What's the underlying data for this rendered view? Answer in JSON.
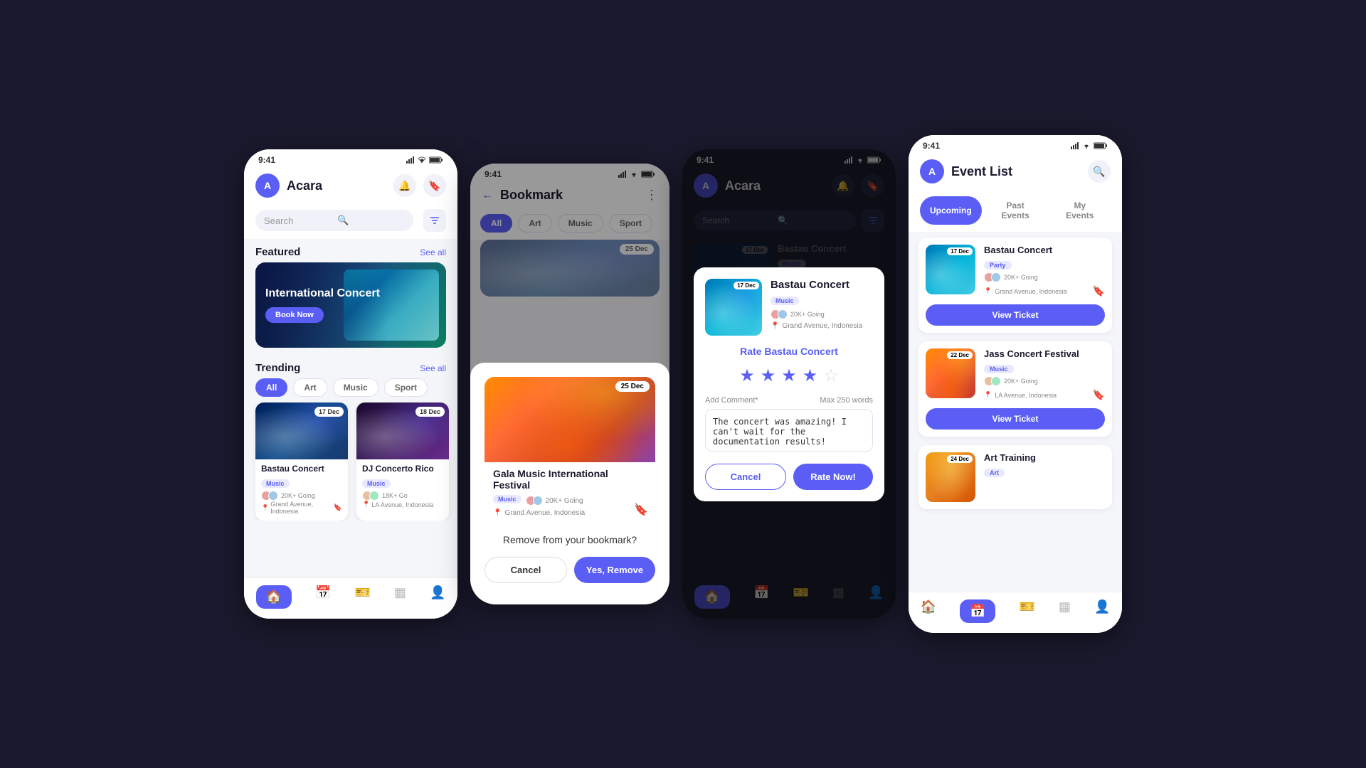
{
  "phone1": {
    "status": {
      "time": "9:41",
      "icons": "▲▲ ▲ ▮▮▮"
    },
    "header": {
      "app_name": "Acara",
      "avatar_letter": "A"
    },
    "search": {
      "placeholder": "Search"
    },
    "featured": {
      "section_label": "Featured",
      "see_all": "See all",
      "card_title": "International Concert",
      "book_btn": "Book Now"
    },
    "trending": {
      "section_label": "Trending",
      "see_all": "See all",
      "categories": [
        "All",
        "Art",
        "Music",
        "Sport"
      ],
      "events": [
        {
          "name": "Bastau Concert",
          "date": "17 Dec",
          "tag": "Music",
          "going": "20K+ Going",
          "location": "Grand Avenue, Indonesia"
        },
        {
          "name": "DJ Concerto Rico",
          "date": "18 Dec",
          "tag": "Music",
          "going": "18K+ Go",
          "location": "LA Avenue, Indonesia"
        }
      ]
    },
    "nav": [
      "home",
      "calendar",
      "ticket",
      "grid",
      "person"
    ]
  },
  "phone2": {
    "status": {
      "time": "9:41"
    },
    "header": {
      "title": "Bookmark"
    },
    "categories": [
      "All",
      "Art",
      "Music",
      "Sport"
    ],
    "card": {
      "date": "25 Dec",
      "name": "Gala Music International Festival",
      "tag": "Music",
      "going": "20K+ Going",
      "location": "Grand Avenue, Indonesia"
    },
    "modal": {
      "question": "Remove from your bookmark?",
      "cancel": "Cancel",
      "confirm": "Yes, Remove"
    }
  },
  "phone3": {
    "status": {
      "time": "9:41"
    },
    "header": {
      "app_name": "Acara",
      "search_placeholder": "Search"
    },
    "rate_modal": {
      "event": {
        "date": "17 Dec",
        "name": "Bastau Concert",
        "tag": "Music",
        "going": "20K+ Going",
        "location": "Grand Avenue, Indonesia"
      },
      "title_prefix": "Rate ",
      "title_event": "Bastau Concert",
      "stars": 4,
      "total_stars": 5,
      "comment_label": "Add Comment*",
      "max_words": "Max 250 words",
      "comment_text": "The concert was amazing! I can't wait for the documentation results!",
      "cancel": "Cancel",
      "rate_now": "Rate Now!"
    },
    "nav": [
      "home",
      "calendar",
      "ticket",
      "grid",
      "person"
    ]
  },
  "phone4": {
    "status": {
      "time": "9:41"
    },
    "header": {
      "title": "Event List"
    },
    "tabs": [
      "Upcoming",
      "Past Events",
      "My Events"
    ],
    "active_tab": 0,
    "events": [
      {
        "date": "17 Dec",
        "name": "Bastau Concert",
        "tag": "Party",
        "going": "20K+ Going",
        "location": "Grand Avenue, Indonesia",
        "img_class": "el-img-1",
        "ticket_btn": "View Ticket"
      },
      {
        "date": "22 Dec",
        "name": "Jass Concert Festival",
        "tag": "Music",
        "going": "20K+ Going",
        "location": "LA Avenue, Indonesia",
        "img_class": "el-img-2",
        "ticket_btn": "View Ticket"
      },
      {
        "date": "24 Dec",
        "name": "Art Training",
        "tag": "Art",
        "going": "",
        "location": "",
        "img_class": "el-img-3",
        "ticket_btn": ""
      }
    ],
    "nav": [
      "home",
      "calendar",
      "ticket",
      "grid",
      "person"
    ]
  }
}
